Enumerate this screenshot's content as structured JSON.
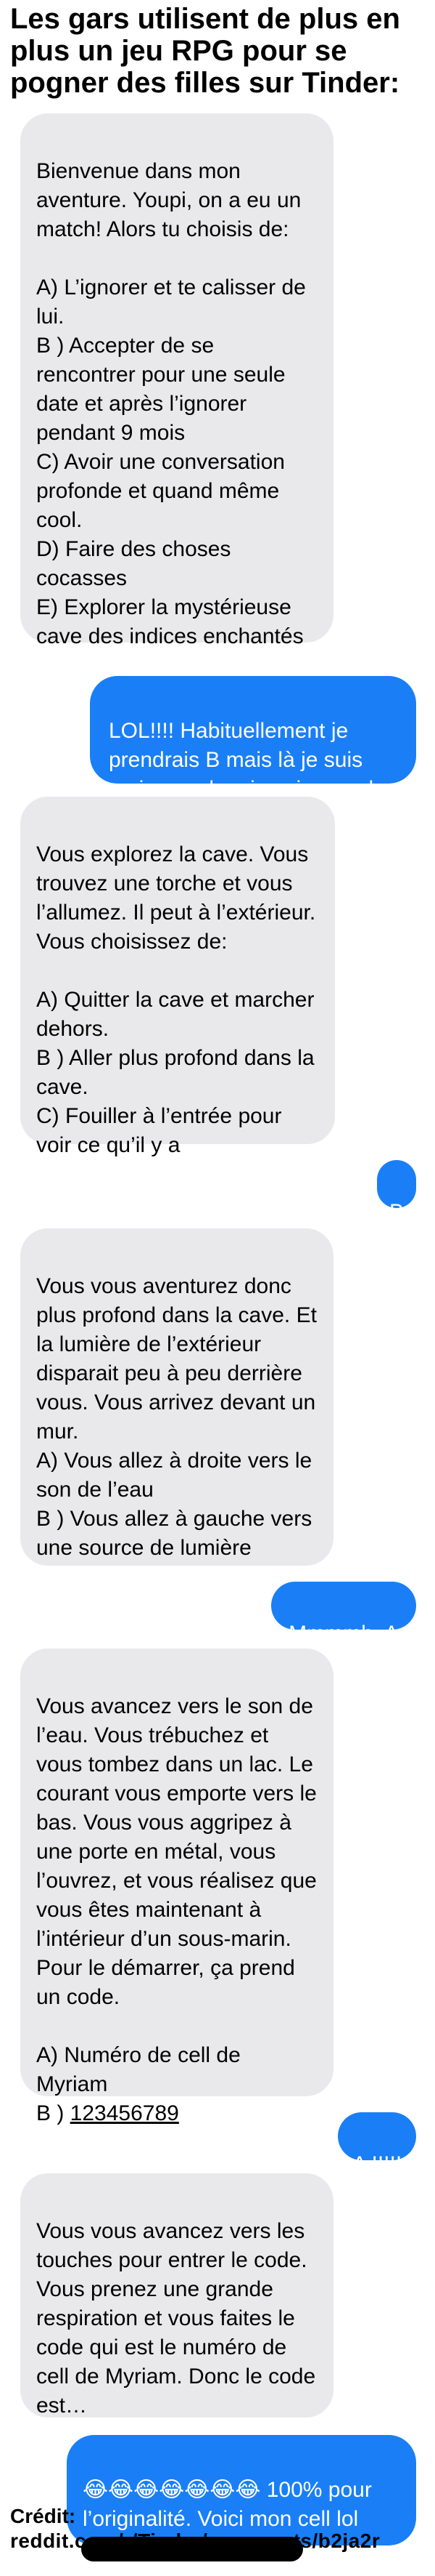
{
  "header": {
    "title": "Les gars utilisent de plus en plus un jeu RPG pour se pogner des filles sur Tinder:"
  },
  "messages": {
    "m1": "Bienvenue dans mon aventure. Youpi, on a eu un match! Alors tu choisis de:",
    "m1_opts": "A) L’ignorer et te calisser de lui.\nB ) Accepter de se rencontrer pour une seule date et après l’ignorer pendant 9 mois\nC) Avoir une conversation profonde et quand même cool.\nD) Faire des choses cocasses\nE) Explorer la mystérieuse cave des indices enchantés",
    "m2": "LOL!!!! Habituellement je prendrais B mais là je suis curieuse alors je vais prendre E",
    "m3": "Vous explorez la cave. Vous trouvez une torche et vous l’allumez. Il peut à l’extérieur. Vous choisissez de:",
    "m3_opts": "A) Quitter la cave et marcher dehors.\nB ) Aller plus profond dans la cave.\nC) Fouiller à l’entrée pour voir ce qu’il y a",
    "m4": "B",
    "m5": "Vous vous aventurez donc plus profond dans la cave. Et la lumière de l’extérieur disparait peu à peu derrière vous. Vous arrivez devant un mur.\nA) Vous allez à droite vers le son de l’eau\nB ) Vous allez à gauche vers une source de lumière",
    "m6": "Mmmmh. A",
    "m7": "Vous avancez vers le son de l’eau. Vous trébuchez et vous tombez dans un lac. Le courant vous emporte vers le bas. Vous vous aggripez à une porte en métal, vous l’ouvrez, et vous réalisez que vous êtes maintenant à l’intérieur d’un sous-marin. Pour le démarrer, ça prend un code.",
    "m7_opt_a": "A) Numéro de cell de Myriam",
    "m7_opt_b_prefix": "B ) ",
    "m7_opt_b_code": "123456789",
    "m8": "A !!!!!",
    "m9": "Vous vous avancez vers les touches pour entrer le code. Vous prenez une grande respiration et vous faites le code qui est le numéro de cell de Myriam. Donc le code est…",
    "m10_emojis": "😂😂😂😂😂😂😂",
    "m10_text": " 100% pour l’originalité. Voici mon cell lol"
  },
  "footer": {
    "credit_label": "Crédit:",
    "credit_url": "reddit.com/r/Tinder/comments/b2ja2r"
  },
  "colors": {
    "received_bubble": "#e9e9eb",
    "sent_bubble": "#1a7ff6",
    "redaction": "#000000"
  }
}
